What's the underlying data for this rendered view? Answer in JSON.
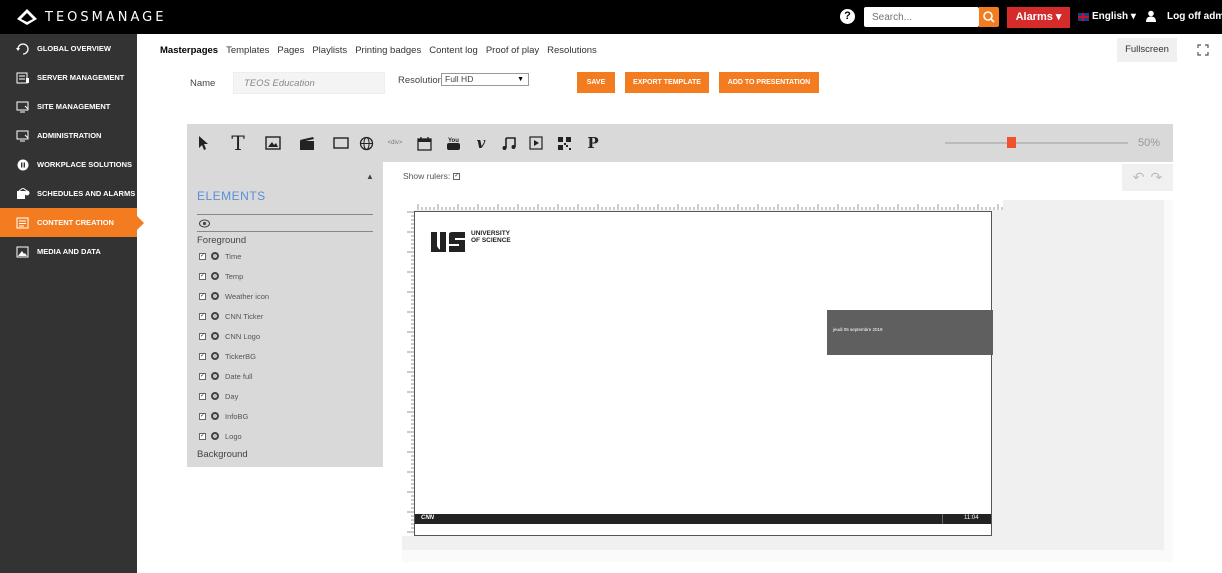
{
  "header": {
    "logo_text": "TEOSMANAGE",
    "search_placeholder": "Search...",
    "alarms_label": "Alarms ▾",
    "language_label": "English ▾",
    "logoff_label": "Log off admin"
  },
  "sidebar": {
    "items": [
      {
        "label": "Global overview",
        "icon": "globe-refresh-icon"
      },
      {
        "label": "Server management",
        "icon": "server-icon"
      },
      {
        "label": "Site management",
        "icon": "monitor-icon"
      },
      {
        "label": "Administration",
        "icon": "admin-monitor-icon"
      },
      {
        "label": "Workplace solutions",
        "icon": "workplace-icon"
      },
      {
        "label": "Schedules and alarms",
        "icon": "schedule-icon"
      },
      {
        "label": "Content creation",
        "icon": "content-icon",
        "active": true
      },
      {
        "label": "Media and data",
        "icon": "media-icon"
      }
    ]
  },
  "tabs": [
    {
      "label": "Masterpages",
      "active": true
    },
    {
      "label": "Templates"
    },
    {
      "label": "Pages"
    },
    {
      "label": "Playlists"
    },
    {
      "label": "Printing badges"
    },
    {
      "label": "Content log"
    },
    {
      "label": "Proof of play"
    },
    {
      "label": "Resolutions"
    }
  ],
  "fullscreen_label": "Fullscreen",
  "form": {
    "name_label": "Name",
    "name_value": "TEOS Education",
    "resolution_label": "Resolution",
    "resolution_value": "Full HD",
    "save_label": "Save",
    "export_label": "Export template",
    "add_label": "Add to presentation"
  },
  "toolbar": {
    "tools": [
      "select-arrow-icon",
      "text-icon",
      "image-icon",
      "video-icon",
      "rectangle-icon",
      "web-icon",
      "html-icon",
      "calendar-icon",
      "youtube-icon",
      "vimeo-icon",
      "music-icon",
      "play-icon",
      "qr-code-icon",
      "p-icon"
    ],
    "html_label": "<div>",
    "zoom_value": "50%",
    "zoom_fraction": 0.5
  },
  "elements_panel": {
    "title": "ELEMENTS",
    "foreground_label": "Foreground",
    "background_label": "Background",
    "layers": [
      "Time",
      "Temp",
      "Weather icon",
      "CNN Ticker",
      "CNN Logo",
      "TickerBG",
      "Date full",
      "Day",
      "InfoBG",
      "Logo"
    ]
  },
  "show_rulers_label": "Show rulers:",
  "stage": {
    "logo_line1": "UNIVERSITY",
    "logo_line2": "OF SCIENCE",
    "date_text": "jeudi 05 septembre 2019",
    "ticker_logo": "CNN",
    "ticker_time": "11:04"
  },
  "colors": {
    "accent": "#f47c20",
    "alarms": "#d62b2b",
    "sidebar": "#333333",
    "panel": "#d9d9d9",
    "title_blue": "#5a8fd6"
  }
}
